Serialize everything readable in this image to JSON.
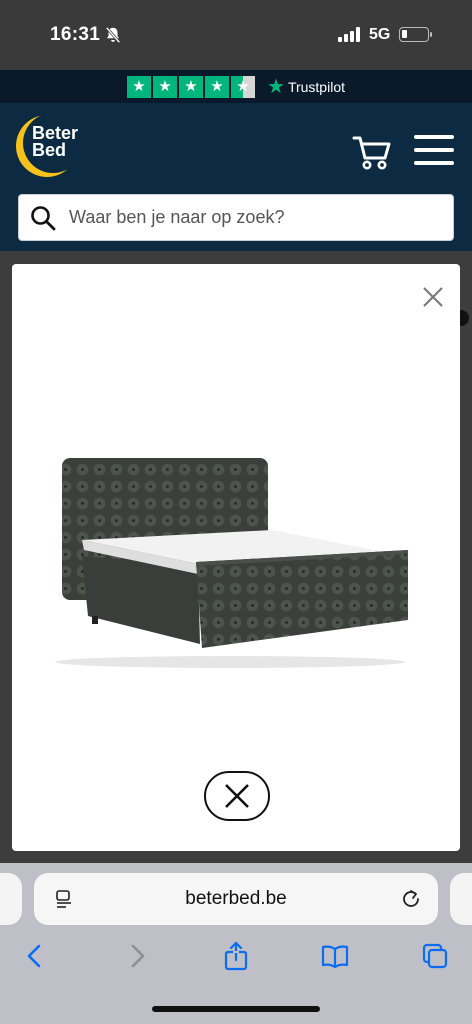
{
  "status_bar": {
    "time": "16:31",
    "network": "5G"
  },
  "trustpilot": {
    "label": "Trustpilot",
    "rating_stars": 4.5
  },
  "header": {
    "logo_line1": "Beter",
    "logo_line2": "Bed",
    "search_placeholder": "Waar ben je naar op zoek?"
  },
  "modal": {
    "image_subject": "dark green tufted boxspring bed"
  },
  "browser": {
    "url": "beterbed.be"
  },
  "icons": {
    "mute": "bell-slash-icon",
    "cart": "cart-icon",
    "menu": "hamburger-menu-icon",
    "search": "search-icon",
    "close": "close-icon",
    "page": "page-menu-icon",
    "reload": "reload-icon",
    "back": "chevron-left-icon",
    "forward": "chevron-right-icon",
    "share": "share-icon",
    "bookmarks": "book-icon",
    "tabs": "tabs-icon"
  },
  "colors": {
    "header_bg": "#0c2b42",
    "trust_green": "#00b67a",
    "logo_yellow": "#f4c21a",
    "ios_blue": "#0a6cf0"
  }
}
